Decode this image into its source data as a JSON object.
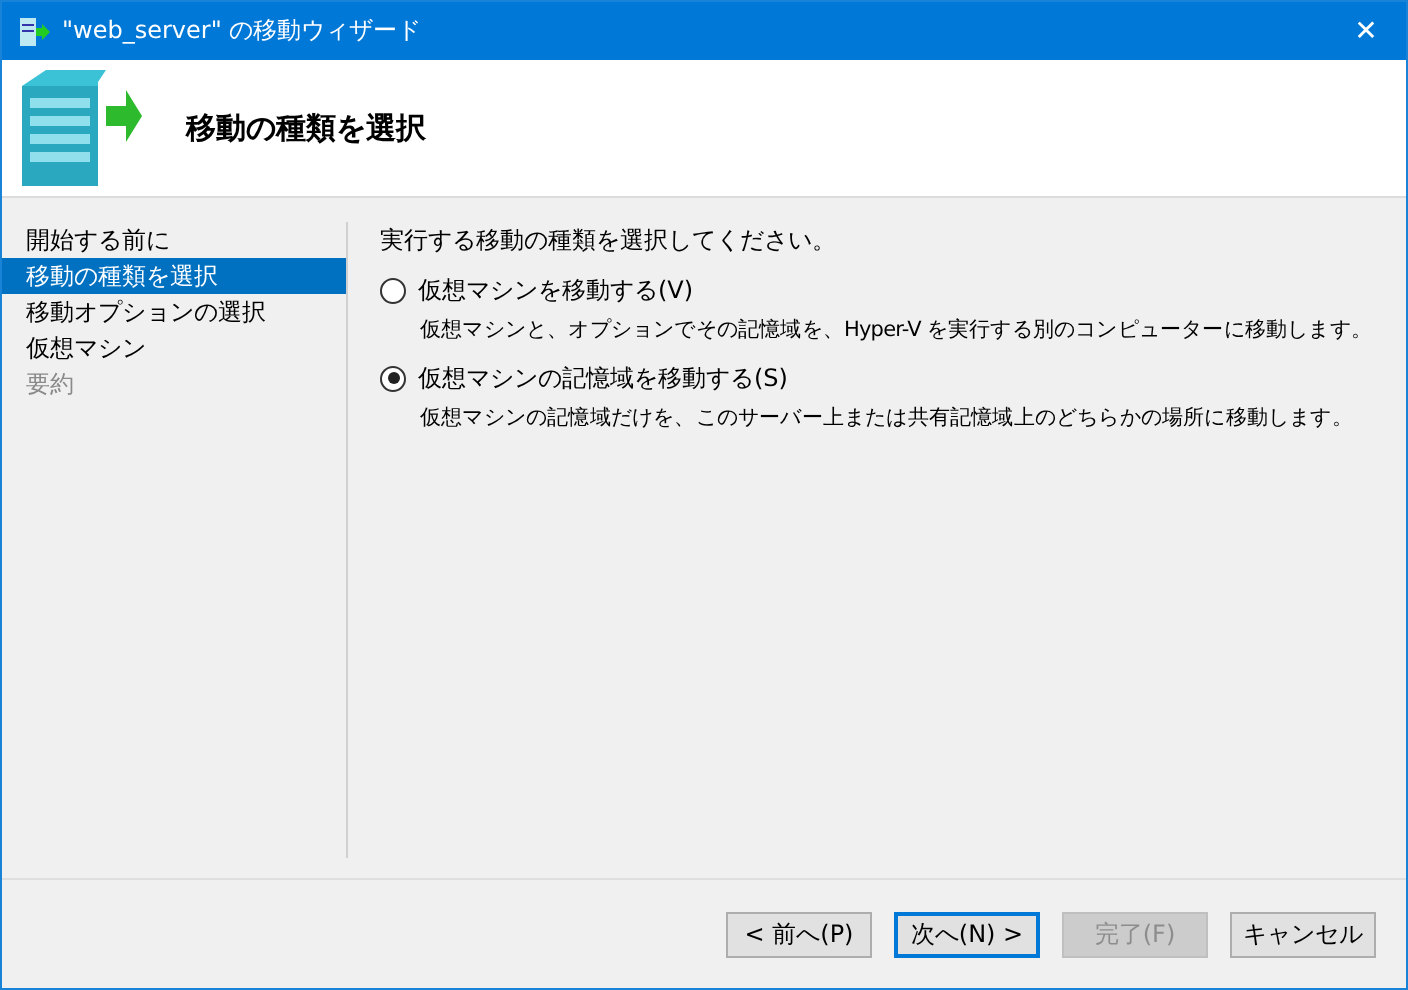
{
  "window": {
    "title": "\"web_server\" の移動ウィザード",
    "close": "✕"
  },
  "header": {
    "title": "移動の種類を選択"
  },
  "sidebar": {
    "items": [
      {
        "label": "開始する前に",
        "selected": false,
        "disabled": false
      },
      {
        "label": "移動の種類を選択",
        "selected": true,
        "disabled": false
      },
      {
        "label": "移動オプションの選択",
        "selected": false,
        "disabled": false
      },
      {
        "label": "仮想マシン",
        "selected": false,
        "disabled": false
      },
      {
        "label": "要約",
        "selected": false,
        "disabled": true
      }
    ]
  },
  "content": {
    "prompt": "実行する移動の種類を選択してください。",
    "options": [
      {
        "label": "仮想マシンを移動する(V)",
        "description": "仮想マシンと、オプションでその記憶域を、Hyper-V を実行する別のコンピューターに移動します。",
        "selected": false
      },
      {
        "label": "仮想マシンの記憶域を移動する(S)",
        "description": "仮想マシンの記憶域だけを、このサーバー上または共有記憶域上のどちらかの場所に移動します。",
        "selected": true
      }
    ]
  },
  "buttons": [
    {
      "label": "< 前へ(P)",
      "disabled": false,
      "default": false
    },
    {
      "label": "次へ(N) >",
      "disabled": false,
      "default": true
    },
    {
      "label": "完了(F)",
      "disabled": true,
      "default": false
    },
    {
      "label": "キャンセル",
      "disabled": false,
      "default": false
    }
  ]
}
